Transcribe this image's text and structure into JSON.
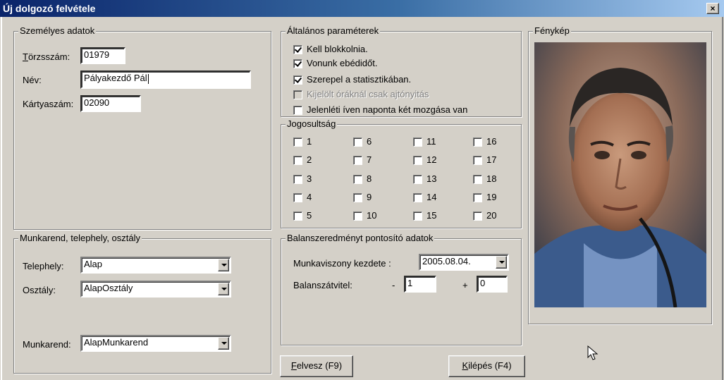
{
  "window": {
    "title": "Új dolgozó felvétele",
    "close_label": "×"
  },
  "personal": {
    "group_title": "Személyes adatok",
    "torzsszam_label_prefix": "T",
    "torzsszam_label_rest": "örzsszám:",
    "torzsszam_value": "01979",
    "nev_label": "Név:",
    "nev_value": "Pályakezdő Pál",
    "kartyaszam_label": "Kártyaszám:",
    "kartyaszam_value": "02090"
  },
  "general": {
    "group_title": "Általános paraméterek",
    "options": [
      {
        "label": "Kell blokkolnia.",
        "checked": true,
        "disabled": false
      },
      {
        "label": "Vonunk ebédidőt.",
        "checked": true,
        "disabled": false
      },
      {
        "label": "Szerepel a statisztikában.",
        "checked": true,
        "disabled": false
      },
      {
        "label": "Kijelölt óráknál csak ajtónyitás",
        "checked": false,
        "disabled": true
      },
      {
        "label": "Jelenléti íven naponta két mozgása van",
        "checked": false,
        "disabled": false
      }
    ]
  },
  "permissions": {
    "group_title": "Jogosultság",
    "items": [
      "1",
      "2",
      "3",
      "4",
      "5",
      "6",
      "7",
      "8",
      "9",
      "10",
      "11",
      "12",
      "13",
      "14",
      "15",
      "16",
      "17",
      "18",
      "19",
      "20"
    ]
  },
  "workplace": {
    "group_title": "Munkarend, telephely, osztály",
    "telephely_label": "Telephely:",
    "telephely_value": "Alap",
    "osztaly_label": "Osztály:",
    "osztaly_value": "AlapOsztály",
    "munkarend_label": "Munkarend:",
    "munkarend_value": "AlapMunkarend"
  },
  "balance": {
    "group_title": "Balanszeredményt pontosító adatok",
    "start_label": "Munkaviszony kezdete :",
    "start_value": "2005.08.04.",
    "transfer_label": "Balanszátvitel:",
    "minus_sign": "-",
    "minus_value": "1",
    "plus_sign": "+",
    "plus_value": "0"
  },
  "photo": {
    "group_title": "Fénykép"
  },
  "buttons": {
    "add_prefix": "F",
    "add_rest": "elvesz (F9)",
    "exit_prefix": "K",
    "exit_rest": "ilépés (F4)"
  }
}
